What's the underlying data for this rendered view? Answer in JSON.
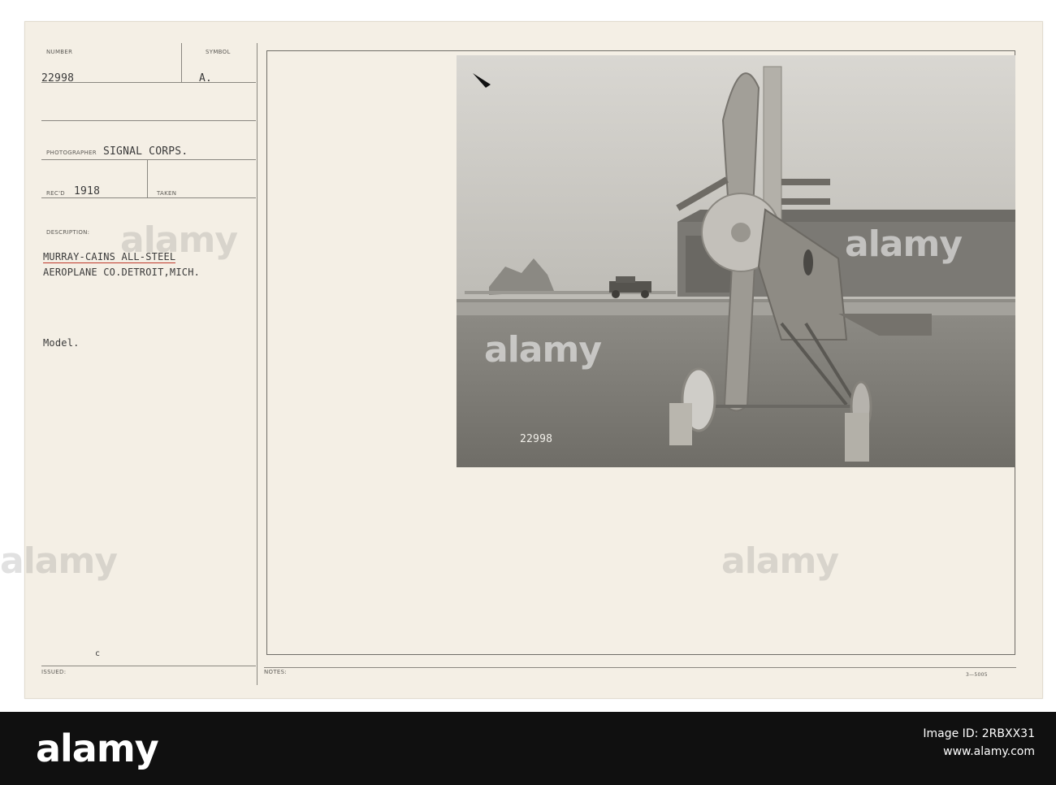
{
  "card": {
    "number_label": "NUMBER",
    "number_value": "22998",
    "symbol_label": "SYMBOL",
    "symbol_value": "A.",
    "photographer_label": "PHOTOGRAPHER",
    "photographer_value": "SIGNAL CORPS.",
    "recd_label": "REC'D",
    "recd_value": "1918",
    "taken_label": "TAKEN",
    "description_label": "DESCRIPTION:",
    "description_line1": "MURRAY-CAINS ALL-STEEL",
    "description_line2": "AEROPLANE CO.DETROIT,MICH.",
    "model_text": "Model.",
    "c_mark": "c",
    "issued_label": "ISSUED:",
    "notes_label": "NOTES:",
    "form_code": "3—5005",
    "negative_number": "22998"
  },
  "watermark": {
    "text": "alamy"
  },
  "footer": {
    "brand": "alamy",
    "image_id_label": "Image ID: 2RBXX31",
    "site": "www.alamy.com"
  },
  "colors": {
    "card_background": "#f4efe5",
    "typed_ink": "#3a3a3a",
    "red_underline": "#c0392b",
    "footer_background": "#101010"
  }
}
